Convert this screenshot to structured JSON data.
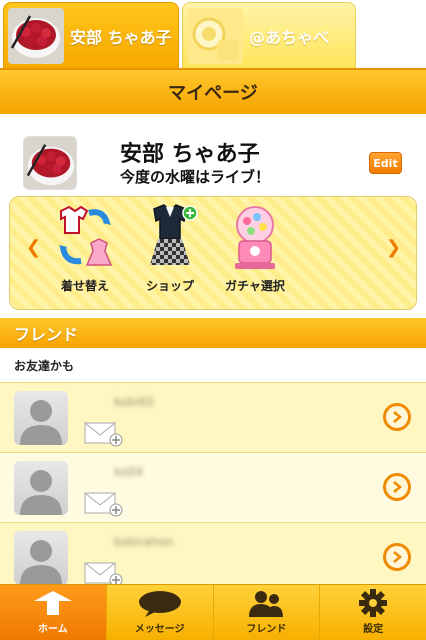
{
  "tabs": [
    {
      "label": "安部 ちゃあ子",
      "active": true,
      "thumb_icon": "raspberry-bowl-photo"
    },
    {
      "label": "@あちゃべ",
      "active": false,
      "thumb_icon": "yellow-cup-photo"
    }
  ],
  "header": {
    "title": "マイページ"
  },
  "profile": {
    "name": "安部 ちゃあ子",
    "status": "今度の水曜はライブ！",
    "edit_label": "Edit",
    "avatar_icon": "raspberry-bowl-photo"
  },
  "menu": {
    "items": [
      {
        "label": "着せ替え",
        "icon": "dress-swap-icon"
      },
      {
        "label": "ショップ",
        "icon": "shop-outfit-icon"
      },
      {
        "label": "ガチャ選択",
        "icon": "gacha-machine-icon"
      }
    ],
    "prev_icon": "chevron-left-icon",
    "next_icon": "chevron-right-icon"
  },
  "friends": {
    "title": "フレンド",
    "subtitle": "お友達かも",
    "rows": [
      {
        "name": "kobi65"
      },
      {
        "name": "ko04"
      },
      {
        "name": "kobirahon"
      }
    ]
  },
  "nav": {
    "items": [
      {
        "label": "ホーム",
        "icon": "home-icon",
        "active": true
      },
      {
        "label": "メッセージ",
        "icon": "message-bubble-icon",
        "active": false
      },
      {
        "label": "フレンド",
        "icon": "friends-icon",
        "active": false
      },
      {
        "label": "設定",
        "icon": "gear-icon",
        "active": false
      }
    ]
  },
  "colors": {
    "accent": "#f6a300",
    "accent_dark": "#f07a00",
    "panel": "#fff4a8"
  }
}
